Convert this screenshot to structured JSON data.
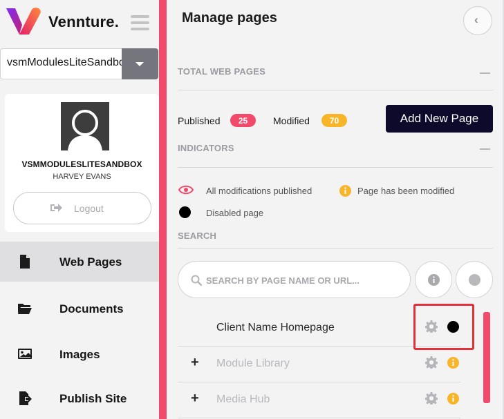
{
  "app": {
    "brand": "Vennture."
  },
  "site_select": {
    "value": "vsmModulesLiteSandbox"
  },
  "profile": {
    "site_name": "VSMMODULESLITESANDBOX",
    "user_name": "HARVEY EVANS",
    "logout_label": "Logout"
  },
  "nav": {
    "items": [
      {
        "label": "Web Pages",
        "icon": "file-icon",
        "active": true
      },
      {
        "label": "Documents",
        "icon": "folder-icon"
      },
      {
        "label": "Images",
        "icon": "image-icon"
      },
      {
        "label": "Publish Site",
        "icon": "publish-icon"
      }
    ]
  },
  "main": {
    "title": "Manage pages",
    "total_section": {
      "label": "TOTAL WEB PAGES"
    },
    "stats": {
      "published_label": "Published",
      "published_count": "25",
      "modified_label": "Modified",
      "modified_count": "70"
    },
    "add_button": "Add New Page",
    "indicators_section": {
      "label": "INDICATORS"
    },
    "indicators": {
      "published": "All modifications published",
      "modified": "Page has been modified",
      "disabled": "Disabled page"
    },
    "search_section": {
      "label": "SEARCH"
    },
    "search": {
      "placeholder": "SEARCH BY PAGE NAME OR URL..."
    },
    "pages": [
      {
        "name": "Client Name Homepage",
        "status": "disabled"
      },
      {
        "name": "Module Library",
        "status": "modified"
      },
      {
        "name": "Media Hub",
        "status": "modified"
      }
    ]
  },
  "colors": {
    "accent_pink": "#f24a6b",
    "warning_yellow": "#f9b52a",
    "navy": "#0d0a2b",
    "highlight_red": "#e0303a"
  }
}
